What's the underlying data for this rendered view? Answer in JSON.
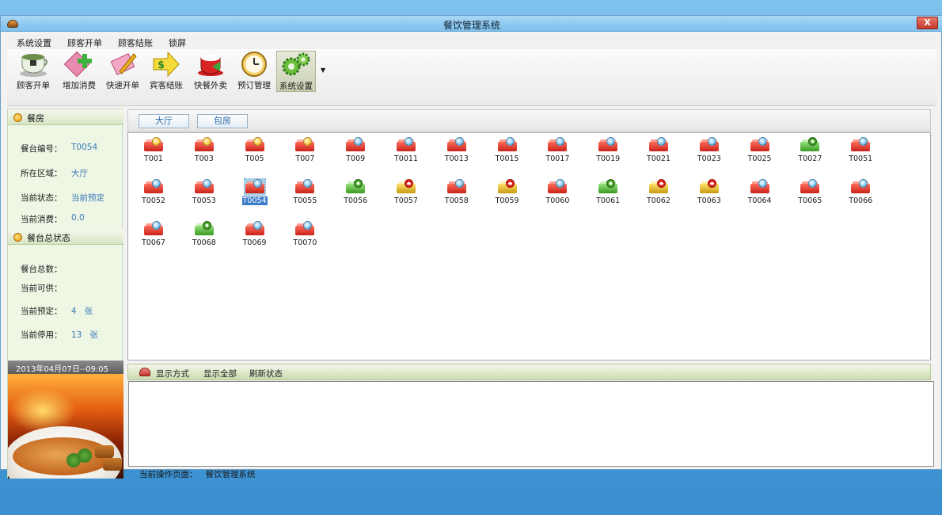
{
  "window": {
    "title": "餐饮管理系统",
    "close_glyph": "X"
  },
  "menu": [
    "系统设置",
    "顾客开单",
    "顾客结账",
    "锁屏"
  ],
  "toolbar": [
    {
      "label": "顾客开单",
      "icon": "tea-cup-icon"
    },
    {
      "label": "增加消费",
      "icon": "add-consume-icon"
    },
    {
      "label": "快速开单",
      "icon": "quick-open-icon"
    },
    {
      "label": "宾客结账",
      "icon": "checkout-icon"
    },
    {
      "label": "快餐外卖",
      "icon": "takeout-icon"
    },
    {
      "label": "预订管理",
      "icon": "clock-icon"
    },
    {
      "label": "系统设置",
      "icon": "gears-icon"
    }
  ],
  "left": {
    "room_header": "餐房",
    "table_no_label": "餐台编号：",
    "table_no": "T0054",
    "area_label": "所在区域：",
    "area": "大厅",
    "state_label": "当前状态：",
    "state": "当前预定",
    "consume_label": "当前消费：",
    "consume": "0.0",
    "summary_header": "餐台总状态",
    "total_label": "餐台总数：",
    "available_label": "当前可供：",
    "reserved_label": "当前预定：",
    "reserved_count": "4",
    "reserved_unit": "张",
    "stopped_label": "当前停用：",
    "stopped_count": "13",
    "stopped_unit": "张",
    "datetime": "2013年04月07日--09:05"
  },
  "area_tabs": [
    "大厅",
    "包房"
  ],
  "tables": [
    {
      "id": "T001",
      "status": "reserved"
    },
    {
      "id": "T003",
      "status": "reserved"
    },
    {
      "id": "T005",
      "status": "reserved"
    },
    {
      "id": "T007",
      "status": "reserved"
    },
    {
      "id": "T009",
      "status": "free"
    },
    {
      "id": "T0011",
      "status": "free"
    },
    {
      "id": "T0013",
      "status": "free"
    },
    {
      "id": "T0015",
      "status": "free"
    },
    {
      "id": "T0017",
      "status": "free"
    },
    {
      "id": "T0019",
      "status": "free"
    },
    {
      "id": "T0021",
      "status": "free"
    },
    {
      "id": "T0023",
      "status": "free"
    },
    {
      "id": "T0025",
      "status": "free"
    },
    {
      "id": "T0027",
      "status": "occupied"
    },
    {
      "id": "T0051",
      "status": "free"
    },
    {
      "id": "T0052",
      "status": "free"
    },
    {
      "id": "T0053",
      "status": "free"
    },
    {
      "id": "T0054",
      "status": "selected"
    },
    {
      "id": "T0055",
      "status": "free"
    },
    {
      "id": "T0056",
      "status": "occupied"
    },
    {
      "id": "T0057",
      "status": "stopped"
    },
    {
      "id": "T0058",
      "status": "free"
    },
    {
      "id": "T0059",
      "status": "stopped"
    },
    {
      "id": "T0060",
      "status": "free"
    },
    {
      "id": "T0061",
      "status": "occupied"
    },
    {
      "id": "T0062",
      "status": "stopped"
    },
    {
      "id": "T0063",
      "status": "stopped"
    },
    {
      "id": "T0064",
      "status": "free"
    },
    {
      "id": "T0065",
      "status": "free"
    },
    {
      "id": "T0066",
      "status": "free"
    },
    {
      "id": "T0067",
      "status": "free"
    },
    {
      "id": "T0068",
      "status": "occupied"
    },
    {
      "id": "T0069",
      "status": "free"
    },
    {
      "id": "T0070",
      "status": "free"
    }
  ],
  "status_bar": {
    "display_mode": "显示方式",
    "show_all": "显示全部",
    "refresh": "刷新状态"
  },
  "footer": {
    "label": "当前操作页面：",
    "value": "餐饮管理系统"
  }
}
